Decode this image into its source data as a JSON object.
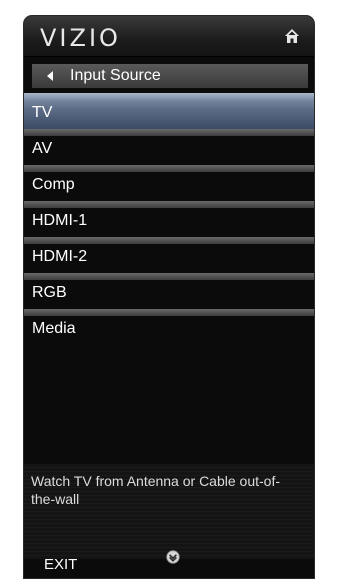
{
  "header": {
    "brand": "VIZIO",
    "home_icon": "home-icon"
  },
  "breadcrumb": {
    "back_icon": "back-arrow-icon",
    "label": "Input Source"
  },
  "menu": {
    "selected_index": 0,
    "items": [
      {
        "label": "TV"
      },
      {
        "label": "AV"
      },
      {
        "label": "Comp"
      },
      {
        "label": "HDMI-1"
      },
      {
        "label": "HDMI-2"
      },
      {
        "label": "RGB"
      },
      {
        "label": "Media"
      }
    ]
  },
  "description": {
    "text": "Watch TV from Antenna or Cable out-of-the-wall"
  },
  "footer": {
    "exit_label": "EXIT",
    "scroll_icon": "scroll-down-icon"
  },
  "colors": {
    "panel_bg": "#0b0b0b",
    "selected_highlight": "#5c6c86",
    "strip": "#5a5a5a",
    "text": "#ffffff"
  }
}
